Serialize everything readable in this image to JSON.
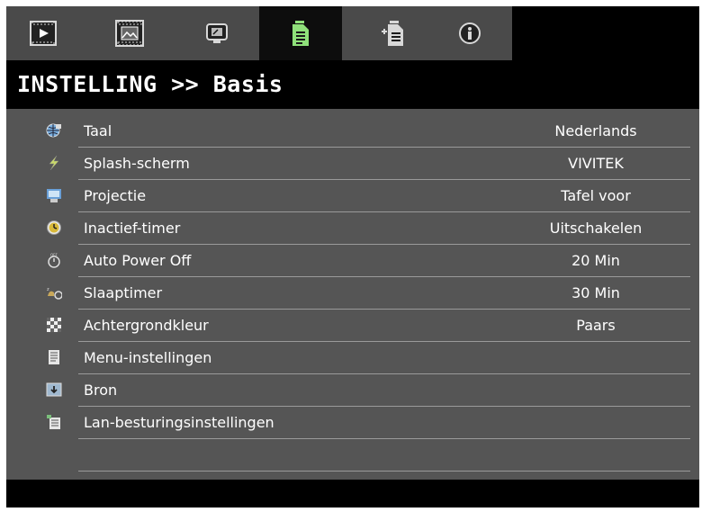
{
  "tabs": [
    {
      "icon": "picture-icon",
      "active": false
    },
    {
      "icon": "film-icon",
      "active": false
    },
    {
      "icon": "display-icon",
      "active": false
    },
    {
      "icon": "document-settings-icon",
      "active": true
    },
    {
      "icon": "document-options-icon",
      "active": false
    },
    {
      "icon": "info-icon",
      "active": false
    }
  ],
  "title": "INSTELLING >> Basis",
  "colors": {
    "active_tab_icon": "#8fe07a",
    "panel": "#555555",
    "tab_bar": "#4a4a4a"
  },
  "menu": {
    "items": [
      {
        "label": "Taal",
        "value": "Nederlands",
        "icon": "globe-icon"
      },
      {
        "label": "Splash-scherm",
        "value": "VIVITEK",
        "icon": "lightning-icon"
      },
      {
        "label": "Projectie",
        "value": "Tafel voor",
        "icon": "projector-icon"
      },
      {
        "label": "Inactief-timer",
        "value": "Uitschakelen",
        "icon": "clock-icon"
      },
      {
        "label": "Auto Power Off",
        "value": "20 Min",
        "icon": "power-off-timer-icon"
      },
      {
        "label": "Slaaptimer",
        "value": "30 Min",
        "icon": "sleep-timer-icon"
      },
      {
        "label": "Achtergrondkleur",
        "value": "Paars",
        "icon": "checker-icon"
      },
      {
        "label": "Menu-instellingen",
        "value": "",
        "icon": "menu-doc-icon"
      },
      {
        "label": "Bron",
        "value": "",
        "icon": "source-icon"
      },
      {
        "label": "Lan-besturingsinstellingen",
        "value": "",
        "icon": "lan-settings-icon"
      },
      {
        "label": "",
        "value": "",
        "icon": ""
      }
    ]
  }
}
